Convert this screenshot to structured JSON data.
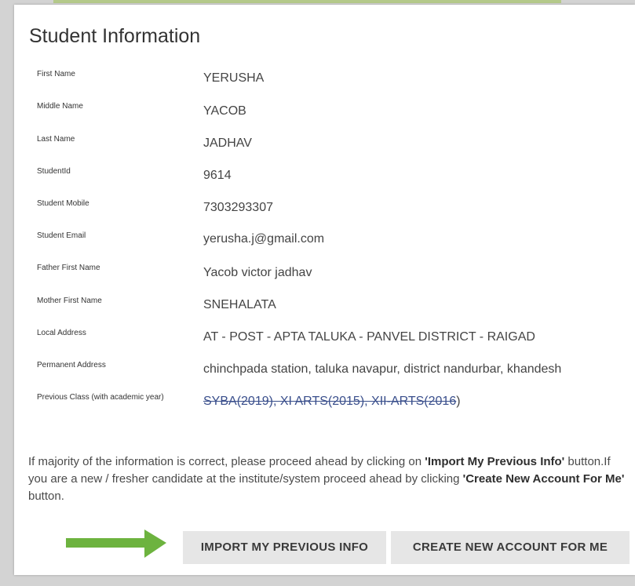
{
  "card": {
    "title": "Student Information"
  },
  "fields": [
    {
      "label": "First Name",
      "value": "YERUSHA"
    },
    {
      "label": "Middle Name",
      "value": "YACOB"
    },
    {
      "label": "Last Name",
      "value": "JADHAV"
    },
    {
      "label": "StudentId",
      "value": "9614"
    },
    {
      "label": "Student Mobile",
      "value": "7303293307"
    },
    {
      "label": "Student Email",
      "value": "yerusha.j@gmail.com"
    },
    {
      "label": "Father First Name",
      "value": "Yacob victor jadhav"
    },
    {
      "label": "Mother First Name",
      "value": "SNEHALATA"
    },
    {
      "label": "Local Address",
      "value": "AT - POST - APTA TALUKA - PANVEL DISTRICT - RAIGAD"
    },
    {
      "label": "Permanent Address",
      "value": "chinchpada station, taluka navapur, district nandurbar, khandesh"
    }
  ],
  "previous_class": {
    "label": "Previous Class (with academic year)",
    "link_text": "SYBA(2019), XI ARTS(2015), XII-ARTS(2016",
    "suffix": ")"
  },
  "info": {
    "part1": "If majority of the information is correct, please proceed ahead by clicking on ",
    "bold1": "'Import My Previous Info'",
    "part2": " button.If you are a new / fresher candidate at the institute/system proceed ahead by clicking ",
    "bold2": "'Create New Account For Me'",
    "part3": " button."
  },
  "buttons": {
    "import_label": "IMPORT MY PREVIOUS INFO",
    "create_label": "CREATE NEW ACCOUNT FOR ME"
  },
  "icons": {
    "arrow": "right-arrow-icon"
  },
  "colors": {
    "arrow": "#6db33f",
    "accent_bar": "#b4c98a",
    "button_bg": "#e6e6e6"
  }
}
